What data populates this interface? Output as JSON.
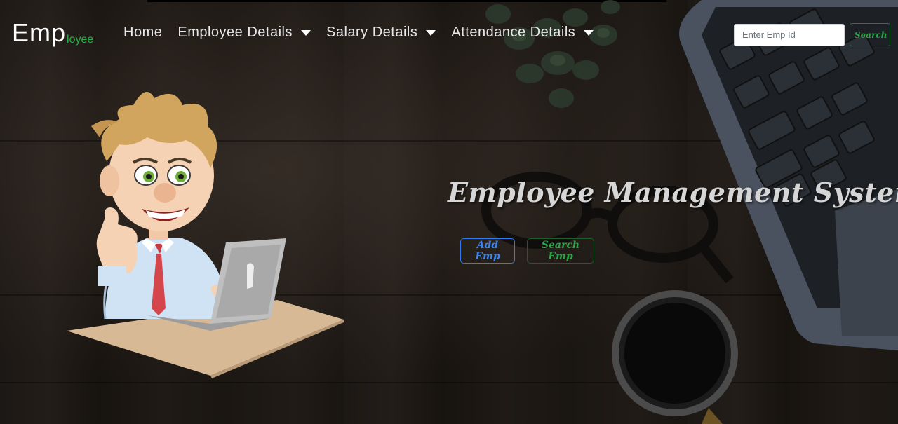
{
  "brand": {
    "main": "Emp",
    "sub": "loyee"
  },
  "nav": {
    "home": "Home",
    "employee_details": "Employee Details",
    "salary_details": "Salary Details",
    "attendance_details": "Attendance Details"
  },
  "search": {
    "placeholder": "Enter Emp Id",
    "value": "",
    "button_label": "Search"
  },
  "hero": {
    "title": "Employee Management System",
    "add_button": "Add Emp",
    "search_button": "Search Emp"
  },
  "colors": {
    "brand_accent": "#28b04a",
    "primary_button": "#3b86f5",
    "success_button": "#28a745"
  },
  "icons": {
    "dropdown": "caret-down-icon",
    "illustration": "employee-with-laptop-illustration",
    "laptop": "laptop-icon",
    "coffee": "coffee-cup-icon",
    "plant": "plant-icon",
    "glasses": "glasses-icon"
  }
}
